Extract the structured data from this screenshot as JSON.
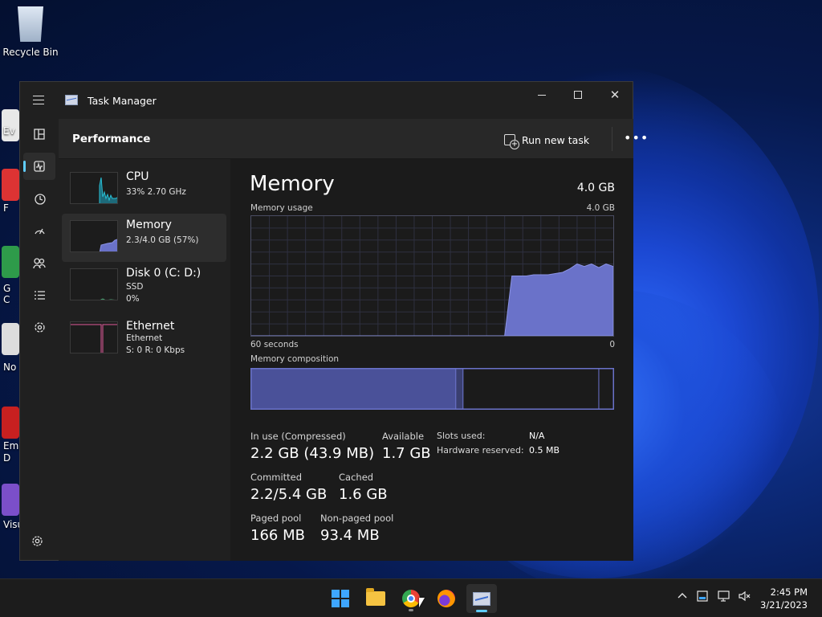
{
  "desktop": {
    "recycle_bin": "Recycle Bin",
    "partial_labels": [
      "Ev",
      "F",
      "G",
      "C",
      "No",
      "Emb",
      "D",
      "Visu"
    ]
  },
  "window": {
    "title": "Task Manager",
    "header_title": "Performance",
    "run_new_task": "Run new task",
    "more": "•••"
  },
  "nav_icons": [
    "hamburger-icon",
    "processes-icon",
    "performance-icon",
    "app-history-icon",
    "startup-apps-icon",
    "users-icon",
    "details-icon",
    "services-icon",
    "settings-icon"
  ],
  "perf_list": [
    {
      "name": "CPU",
      "sub1": "33%  2.70 GHz",
      "sub2": ""
    },
    {
      "name": "Memory",
      "sub1": "2.3/4.0 GB (57%)",
      "sub2": ""
    },
    {
      "name": "Disk 0 (C: D:)",
      "sub1": "SSD",
      "sub2": "0%"
    },
    {
      "name": "Ethernet",
      "sub1": "Ethernet",
      "sub2": "S: 0  R: 0 Kbps"
    }
  ],
  "memory": {
    "title": "Memory",
    "total": "4.0 GB",
    "usage_label": "Memory usage",
    "usage_max": "4.0 GB",
    "axis_left": "60 seconds",
    "axis_right": "0",
    "composition_label": "Memory composition",
    "composition": {
      "in_use_fraction": 0.565,
      "modified_fraction": 0.02,
      "standby_fraction": 0.375,
      "free_fraction": 0.04
    },
    "in_use_label": "In use (Compressed)",
    "in_use_value": "2.2 GB (43.9 MB)",
    "available_label": "Available",
    "available_value": "1.7 GB",
    "committed_label": "Committed",
    "committed_value": "2.2/5.4 GB",
    "cached_label": "Cached",
    "cached_value": "1.6 GB",
    "paged_label": "Paged pool",
    "paged_value": "166 MB",
    "nonpaged_label": "Non-paged pool",
    "nonpaged_value": "93.4 MB",
    "slots_label": "Slots used:",
    "slots_value": "N/A",
    "hw_label": "Hardware reserved:",
    "hw_value": "0.5 MB"
  },
  "usage_series": [
    0,
    0,
    0,
    0,
    0,
    0,
    0,
    0,
    0,
    0,
    0,
    0,
    0,
    0,
    0,
    0,
    0,
    0,
    0,
    0,
    0,
    0,
    0,
    0,
    0,
    0,
    0,
    0,
    0,
    0,
    0,
    0,
    0,
    0,
    0,
    0,
    0.5,
    0.5,
    0.5,
    0.51,
    0.51,
    0.51,
    0.52,
    0.53,
    0.56,
    0.6,
    0.58,
    0.6,
    0.57,
    0.6,
    0.58
  ],
  "taskbar": {
    "apps": [
      "start",
      "file-explorer",
      "chrome",
      "firefox",
      "task-manager"
    ],
    "time": "2:45 PM",
    "date": "3/21/2023"
  },
  "colors": {
    "accent": "#60cdff",
    "graph_fill": "#6a72c9",
    "graph_line": "#8b93e6"
  }
}
